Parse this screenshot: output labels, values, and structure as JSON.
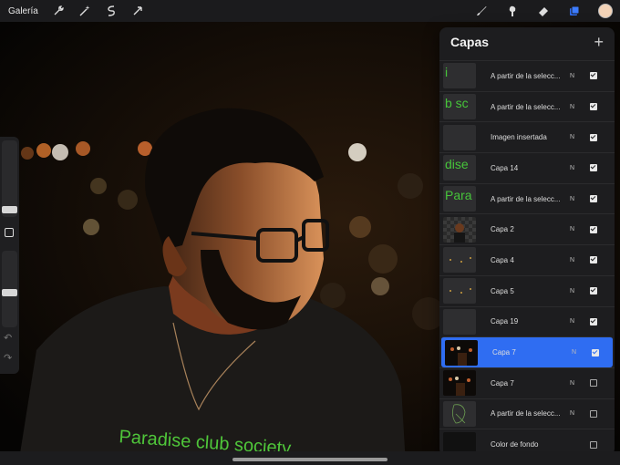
{
  "toolbar": {
    "gallery_label": "Galería",
    "left_tools": [
      "wrench-icon",
      "magic-wand-icon",
      "selection-icon",
      "transform-icon"
    ],
    "right_tools": [
      "brush-icon",
      "smudge-icon",
      "eraser-icon",
      "layers-icon"
    ],
    "color": "#f3d3b7"
  },
  "artwork": {
    "shirt_text": "Paradise club society"
  },
  "layers_panel": {
    "title": "Capas",
    "add_symbol": "+",
    "layers": [
      {
        "name": "A partir de la selecc...",
        "mode": "N",
        "visible": true,
        "thumb": "green-text",
        "thumb_text": "i"
      },
      {
        "name": "A partir de la selecc...",
        "mode": "N",
        "visible": true,
        "thumb": "green-text",
        "thumb_text": "b sc"
      },
      {
        "name": "Imagen insertada",
        "mode": "N",
        "visible": true,
        "thumb": "blank"
      },
      {
        "name": "Capa 14",
        "mode": "N",
        "visible": true,
        "thumb": "green-text",
        "thumb_text": "dise"
      },
      {
        "name": "A partir de la selecc...",
        "mode": "N",
        "visible": true,
        "thumb": "green-text",
        "thumb_text": "Para"
      },
      {
        "name": "Capa 2",
        "mode": "N",
        "visible": true,
        "thumb": "portrait"
      },
      {
        "name": "Capa 4",
        "mode": "N",
        "visible": true,
        "thumb": "dots"
      },
      {
        "name": "Capa 5",
        "mode": "N",
        "visible": true,
        "thumb": "dots"
      },
      {
        "name": "Capa 19",
        "mode": "N",
        "visible": true,
        "thumb": "blank"
      },
      {
        "name": "Capa 7",
        "mode": "N",
        "visible": true,
        "thumb": "night",
        "active": true
      },
      {
        "name": "Capa 7",
        "mode": "N",
        "visible": false,
        "thumb": "night"
      },
      {
        "name": "A partir de la selecc...",
        "mode": "N",
        "visible": false,
        "thumb": "sketch"
      },
      {
        "name": "Color de fondo",
        "mode": "",
        "visible": false,
        "thumb": "black"
      }
    ]
  }
}
